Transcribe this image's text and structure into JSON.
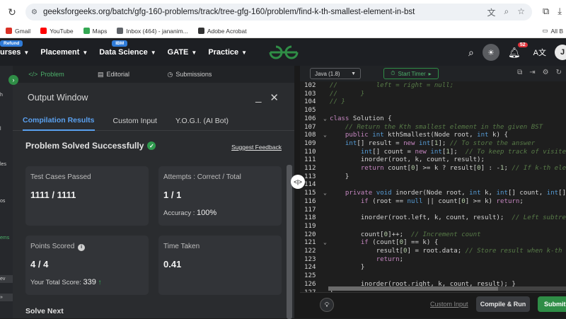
{
  "browser": {
    "url": "geeksforgeeks.org/batch/gfg-160-problems/track/tree-gfg-160/problem/find-k-th-smallest-element-in-bst",
    "bookmarks": [
      {
        "label": "Gmail",
        "color": "#d93025"
      },
      {
        "label": "YouTube",
        "color": "#ff0000"
      },
      {
        "label": "Maps",
        "color": "#34a853"
      },
      {
        "label": "Inbox (464) - jananim...",
        "color": "#5f6368"
      },
      {
        "label": "Adobe Acrobat",
        "color": "#333333"
      }
    ],
    "bookmarks_right": "All B"
  },
  "header": {
    "refund_tag": "Refund",
    "ibm_tag": "IBM",
    "nav": [
      "urses",
      "Placement",
      "Data Science",
      "GATE",
      "Practice"
    ],
    "notifications": "52",
    "avatar_letter": "J"
  },
  "rail": {
    "labels": [
      "h",
      "l",
      "les",
      "os",
      "ems",
      "ev"
    ]
  },
  "problem_tabs": {
    "problem": "Problem",
    "editorial": "Editorial",
    "submissions": "Submissions"
  },
  "output": {
    "title": "Output Window",
    "subtabs": [
      "Compilation Results",
      "Custom Input",
      "Y.O.G.I. (AI Bot)"
    ],
    "status": "Problem Solved Successfully",
    "feedback": "Suggest Feedback",
    "test_cases_label": "Test Cases Passed",
    "test_cases_value": "1111 / 1111",
    "attempts_label": "Attempts : Correct / Total",
    "attempts_value": "1 / 1",
    "accuracy_label": "Accuracy :",
    "accuracy_value": "100%",
    "points_label": "Points Scored",
    "points_value": "4 / 4",
    "total_score_label": "Your Total Score:",
    "total_score_value": "339",
    "time_label": "Time Taken",
    "time_value": "0.41",
    "solve_next": "Solve Next"
  },
  "editor": {
    "language": "Java (1.8)",
    "timer": "Start Timer",
    "lines": [
      {
        "n": "102",
        "html": "<span class='cm'>//          left = right = null;</span>"
      },
      {
        "n": "103",
        "html": "<span class='cm'>//      }</span>"
      },
      {
        "n": "104",
        "html": "<span class='cm'>// }</span>"
      },
      {
        "n": "105",
        "html": ""
      },
      {
        "n": "106",
        "html": "<span class='kw'>class</span> <span class='tx'>Solution {</span>"
      },
      {
        "n": "107",
        "html": "    <span class='cm'>// Return the Kth smallest element in the given BST</span>"
      },
      {
        "n": "108",
        "html": "    <span class='kw'>public</span> <span class='kw2'>int</span> <span class='tx'>kthSmallest(Node root,</span> <span class='kw2'>int</span> <span class='tx'>k) {</span>"
      },
      {
        "n": "109",
        "html": "    <span class='kw2'>int</span><span class='tx'>[] result =</span> <span class='kw'>new</span> <span class='kw2'>int</span><span class='tx'>[</span><span class='nm'>1</span><span class='tx'>];</span> <span class='cm'>// To store the answer</span>"
      },
      {
        "n": "110",
        "html": "        <span class='kw2'>int</span><span class='tx'>[] count =</span> <span class='kw'>new</span> <span class='kw2'>int</span><span class='tx'>[</span><span class='nm'>1</span><span class='tx'>];</span>  <span class='cm'>// To keep track of visited</span>"
      },
      {
        "n": "111",
        "html": "        <span class='tx'>inorder(root, k, count, result);</span>"
      },
      {
        "n": "112",
        "html": "        <span class='kw'>return</span> <span class='tx'>count[</span><span class='nm'>0</span><span class='tx'>] &gt;= k ? result[</span><span class='nm'>0</span><span class='tx'>] : -</span><span class='nm'>1</span><span class='tx'>;</span> <span class='cm'>// If k-th ele</span>"
      },
      {
        "n": "113",
        "html": "    <span class='tx'>}</span>"
      },
      {
        "n": "114",
        "html": ""
      },
      {
        "n": "115",
        "html": "    <span class='kw'>private</span> <span class='kw2'>void</span> <span class='tx'>inorder(Node root,</span> <span class='kw2'>int</span> <span class='tx'>k,</span> <span class='kw2'>int</span><span class='tx'>[] count,</span> <span class='kw2'>int</span><span class='tx'>[]</span>"
      },
      {
        "n": "116",
        "html": "        <span class='kw'>if</span> <span class='tx'>(root ==</span> <span class='kw2'>null</span> <span class='tx'>|| count[</span><span class='nm'>0</span><span class='tx'>] &gt;= k)</span> <span class='kw'>return</span><span class='tx'>;</span>"
      },
      {
        "n": "117",
        "html": ""
      },
      {
        "n": "118",
        "html": "        <span class='tx'>inorder(root.left, k, count, result);</span>  <span class='cm'>// Left subtree</span>"
      },
      {
        "n": "119",
        "html": ""
      },
      {
        "n": "120",
        "html": "        <span class='tx'>count[</span><span class='nm'>0</span><span class='tx'>]++;</span>  <span class='cm'>// Increment count</span>"
      },
      {
        "n": "121",
        "html": "        <span class='kw'>if</span> <span class='tx'>(count[</span><span class='nm'>0</span><span class='tx'>] == k) {</span>"
      },
      {
        "n": "122",
        "html": "            <span class='tx'>result[</span><span class='nm'>0</span><span class='tx'>] = root.data;</span> <span class='cm'>// Store result when k-th s</span>"
      },
      {
        "n": "123",
        "html": "            <span class='kw'>return</span><span class='tx'>;</span>"
      },
      {
        "n": "124",
        "html": "        <span class='tx'>}</span>"
      },
      {
        "n": "125",
        "html": ""
      },
      {
        "n": "126",
        "html": "        <span class='tx'>inorder(root.right, k, count, result); }</span>"
      },
      {
        "n": "127",
        "html": "<span class='tx'>}</span>"
      }
    ],
    "folds": [
      "106",
      "108",
      "115",
      "121"
    ],
    "custom_input": "Custom Input",
    "compile_run": "Compile & Run",
    "submit": "Submit"
  },
  "colors": {
    "accent_green": "#2f8d46",
    "link_blue": "#5aa0ef",
    "notif_red": "#e0323b"
  }
}
